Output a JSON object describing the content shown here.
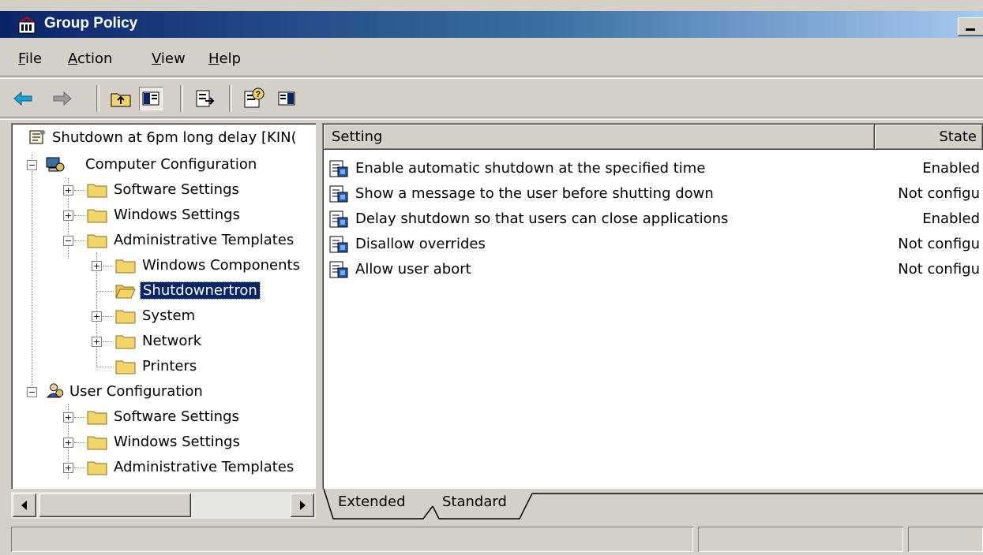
{
  "window": {
    "title": "Group Policy"
  },
  "menu": [
    "File",
    "Action",
    "View",
    "Help"
  ],
  "toolbar": {
    "icons": [
      "back-arrow-icon",
      "forward-arrow-icon",
      "up-one-level-icon",
      "show-hide-tree-icon",
      "export-list-icon",
      "help-icon",
      "show-hide-action-pane-icon"
    ]
  },
  "tree": {
    "root": "Shutdown at 6pm long delay [KIN(",
    "computer_configuration": "Computer Configuration",
    "cc_software_settings": "Software Settings",
    "cc_windows_settings": "Windows Settings",
    "cc_administrative_templates": "Administrative Templates",
    "windows_components": "Windows Components",
    "shutdownertron": "Shutdownertron",
    "system": "System",
    "network": "Network",
    "printers": "Printers",
    "user_configuration": "User Configuration",
    "uc_software_settings": "Software Settings",
    "uc_windows_settings": "Windows Settings",
    "uc_administrative_templates": "Administrative Templates"
  },
  "list": {
    "columns": {
      "setting": "Setting",
      "state": "State"
    },
    "rows": [
      {
        "setting": "Enable automatic shutdown at the specified time",
        "state": "Enabled"
      },
      {
        "setting": "Show a message to the user before shutting down",
        "state": "Not configu"
      },
      {
        "setting": "Delay shutdown so that users can close applications",
        "state": "Enabled"
      },
      {
        "setting": "Disallow overrides",
        "state": "Not configu"
      },
      {
        "setting": "Allow user abort",
        "state": "Not configu"
      }
    ]
  },
  "tabs": [
    "Extended",
    "Standard"
  ],
  "colors": {
    "titlebar_start": "#0a246a",
    "titlebar_end": "#a6caf0",
    "selection": "#0a246a",
    "chrome": "#d4d0c8",
    "folder": "#f4d569"
  }
}
